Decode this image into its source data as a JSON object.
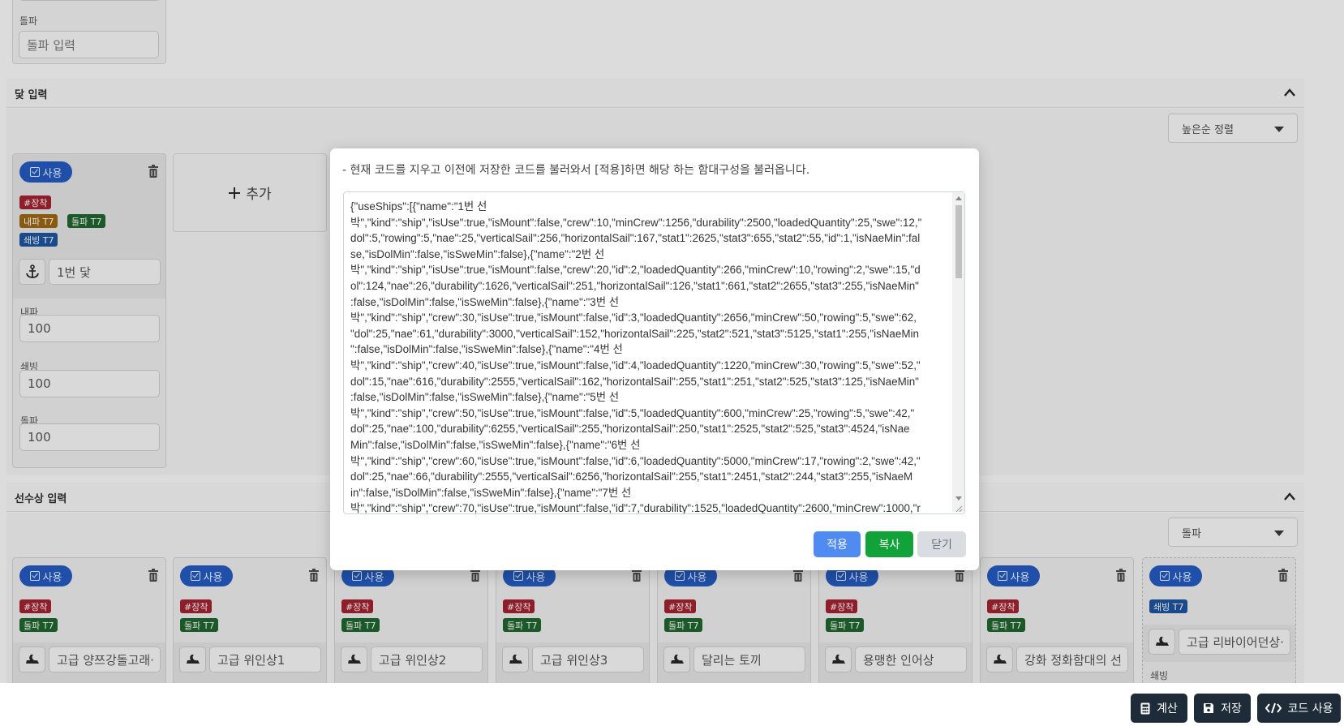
{
  "top_form": {
    "dolpa_label": "돌파",
    "dolpa_placeholder": "돌파 입력"
  },
  "anchor_section": {
    "title": "닻 입력",
    "sort_select": "높은순 정렬",
    "card": {
      "use_label": "사용",
      "tags": [
        "#장착",
        "내파 T7",
        "돌파 T7",
        "쇄빙 T7"
      ],
      "name": "1번 닻",
      "fields": [
        {
          "label": "내파",
          "value": "100"
        },
        {
          "label": "쇄빙",
          "value": "100"
        },
        {
          "label": "돌파",
          "value": "100"
        }
      ]
    },
    "add_label": "추가"
  },
  "figurehead_section": {
    "title": "선수상 입력",
    "sort_select": "돌파",
    "cards": [
      {
        "use": "사용",
        "tag1": "#장착",
        "tag2": "돌파 T7",
        "name": "고급 양쯔강돌고래·"
      },
      {
        "use": "사용",
        "tag1": "#장착",
        "tag2": "돌파 T7",
        "name": "고급 위인상1"
      },
      {
        "use": "사용",
        "tag1": "#장착",
        "tag2": "돌파 T7",
        "name": "고급 위인상2"
      },
      {
        "use": "사용",
        "tag1": "#장착",
        "tag2": "돌파 T7",
        "name": "고급 위인상3"
      },
      {
        "use": "사용",
        "tag1": "#장착",
        "tag2": "돌파 T7",
        "name": "달리는 토끼"
      },
      {
        "use": "사용",
        "tag1": "#장착",
        "tag2": "돌파 T7",
        "name": "용맹한 인어상"
      },
      {
        "use": "사용",
        "tag1": "#장착",
        "tag2": "돌파 T7",
        "name": "강화 정화함대의 선"
      }
    ],
    "last_card": {
      "use": "사용",
      "tag1": "쇄빙 T7",
      "name": "고급 리바이어던상·",
      "field_label": "쇄빙"
    }
  },
  "modal": {
    "description": "- 현재 코드를 지우고 이전에 저장한 코드를 불러와서 [적용]하면 해당 하는 함대구성을 불러옵니다.",
    "code_lines": [
      "{\"useShips\":[{\"name\":\"1번 선",
      "박\",\"kind\":\"ship\",\"isUse\":true,\"isMount\":false,\"crew\":10,\"minCrew\":1256,\"durability\":2500,\"loadedQuantity\":25,\"swe\":12,\"",
      "dol\":5,\"rowing\":5,\"nae\":25,\"verticalSail\":256,\"horizontalSail\":167,\"stat1\":2625,\"stat3\":655,\"stat2\":55,\"id\":1,\"isNaeMin\":fal",
      "se,\"isDolMin\":false,\"isSweMin\":false},{\"name\":\"2번 선",
      "박\",\"kind\":\"ship\",\"isUse\":true,\"isMount\":false,\"crew\":20,\"id\":2,\"loadedQuantity\":266,\"minCrew\":10,\"rowing\":2,\"swe\":15,\"d",
      "ol\":124,\"nae\":26,\"durability\":1626,\"verticalSail\":251,\"horizontalSail\":126,\"stat1\":661,\"stat2\":2655,\"stat3\":255,\"isNaeMin\"",
      ":false,\"isDolMin\":false,\"isSweMin\":false},{\"name\":\"3번 선",
      "박\",\"kind\":\"ship\",\"crew\":30,\"isUse\":true,\"isMount\":false,\"id\":3,\"loadedQuantity\":2656,\"minCrew\":50,\"rowing\":5,\"swe\":62,",
      "\"dol\":25,\"nae\":61,\"durability\":3000,\"verticalSail\":152,\"horizontalSail\":225,\"stat2\":521,\"stat3\":5125,\"stat1\":255,\"isNaeMin",
      "\":false,\"isDolMin\":false,\"isSweMin\":false},{\"name\":\"4번 선",
      "박\",\"kind\":\"ship\",\"crew\":40,\"isUse\":true,\"isMount\":false,\"id\":4,\"loadedQuantity\":1220,\"minCrew\":30,\"rowing\":5,\"swe\":52,\"",
      "dol\":15,\"nae\":616,\"durability\":2555,\"verticalSail\":162,\"horizontalSail\":255,\"stat1\":251,\"stat2\":525,\"stat3\":125,\"isNaeMin\"",
      ":false,\"isDolMin\":false,\"isSweMin\":false},{\"name\":\"5번 선",
      "박\",\"kind\":\"ship\",\"crew\":50,\"isUse\":true,\"isMount\":false,\"id\":5,\"loadedQuantity\":600,\"minCrew\":25,\"rowing\":5,\"swe\":42,\"",
      "dol\":25,\"nae\":100,\"durability\":6255,\"verticalSail\":255,\"horizontalSail\":250,\"stat1\":2525,\"stat2\":525,\"stat3\":4524,\"isNae",
      "Min\":false,\"isDolMin\":false,\"isSweMin\":false},{\"name\":\"6번 선",
      "박\",\"kind\":\"ship\",\"crew\":60,\"isUse\":true,\"isMount\":false,\"id\":6,\"loadedQuantity\":5000,\"minCrew\":17,\"rowing\":2,\"swe\":42,\"",
      "dol\":25,\"nae\":66,\"durability\":2555,\"verticalSail\":6256,\"horizontalSail\":255,\"stat1\":2451,\"stat2\":244,\"stat3\":255,\"isNaeM",
      "in\":false,\"isDolMin\":false,\"isSweMin\":false},{\"name\":\"7번 선",
      "박\",\"kind\":\"ship\",\"crew\":70,\"isUse\":true,\"isMount\":false,\"id\":7,\"durability\":1525,\"loadedQuantity\":2600,\"minCrew\":1000,\"r"
    ],
    "apply_label": "적용",
    "copy_label": "복사",
    "close_label": "닫기"
  },
  "footer": {
    "calc_label": "계산",
    "save_label": "저장",
    "code_label": "코드 사용"
  },
  "colors": {
    "apply": "#4f8bf0",
    "copy": "#12a23a",
    "close": "#d9dde2",
    "footer_button": "#1e2b38",
    "use_pill": "#1f4fa8"
  }
}
